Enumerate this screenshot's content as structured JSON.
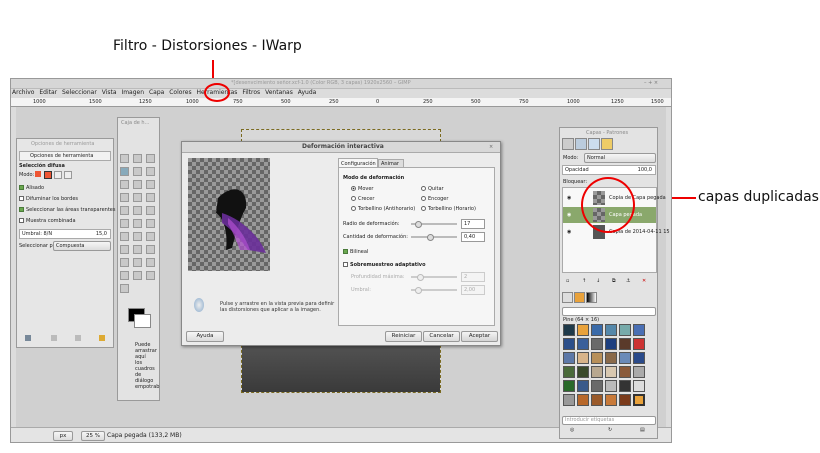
{
  "annotations": {
    "main_caption": "Filtro - Distorsiones - IWarp",
    "side_caption": "capas duplicadas"
  },
  "app": {
    "title": "*[desenvcimiento señor.xcf-1.0 (Color RGB, 3 capas) 1920x2560 – GIMP",
    "menu": [
      "Archivo",
      "Editar",
      "Seleccionar",
      "Vista",
      "Imagen",
      "Capa",
      "Colores",
      "Herramientas",
      "Filtros",
      "Ventanas",
      "Ayuda"
    ],
    "ruler_marks": [
      "1000",
      "1500",
      "1250",
      "1000",
      "750",
      "500",
      "250",
      "0",
      "250",
      "500",
      "750",
      "1000",
      "1250",
      "1500",
      "1750",
      "2000"
    ],
    "status": {
      "unit": "px",
      "zoom": "25 %",
      "message": "Capa pegada (133,2 MB)"
    }
  },
  "tool_options": {
    "title": "Opciones de herramienta",
    "tab": "Opciones de herramienta",
    "section": "Selección difusa",
    "mode_label": "Modo:",
    "options": [
      {
        "label": "Alisado",
        "checked": true
      },
      {
        "label": "Difuminar los bordes",
        "checked": false
      },
      {
        "label": "Seleccionar las áreas transparentes",
        "checked": true
      },
      {
        "label": "Muestra combinada",
        "checked": false
      }
    ],
    "threshold_label": "Umbral: 8/N",
    "threshold_value": "15,0",
    "select_by_label": "Seleccionar por:",
    "select_by_value": "Compuesta"
  },
  "toolbox": {
    "title": "Caja de h...",
    "hint": [
      "Puede",
      "arrastrar",
      "aquí",
      "los",
      "cuadros",
      "de",
      "diálogo",
      "empotrab"
    ]
  },
  "dialog": {
    "title": "Deformación interactiva",
    "tabs": [
      "Configuración",
      "Animar"
    ],
    "mode_heading": "Modo de deformación",
    "modes": [
      {
        "label": "Mover",
        "selected": true
      },
      {
        "label": "Quitar",
        "selected": false
      },
      {
        "label": "Crecer",
        "selected": false
      },
      {
        "label": "Encoger",
        "selected": false
      },
      {
        "label": "Torbellino (Antihorario)",
        "selected": false
      },
      {
        "label": "Torbellino (Horario)",
        "selected": false
      }
    ],
    "radius_label": "Radio de deformación:",
    "radius_value": "17",
    "amount_label": "Cantidad de deformación:",
    "amount_value": "0,40",
    "bilinear_label": "Bilineal",
    "bilinear_checked": true,
    "supersample_label": "Sobremuestreo adaptativo",
    "supersample_checked": false,
    "depth_label": "Profundidad máxima:",
    "depth_value": "2",
    "threshold_label": "Umbral:",
    "threshold_value": "2,00",
    "hint": "Pulse y arrastre en la vista previa para definir las distorsiones que aplicar a la imagen.",
    "buttons": {
      "help": "Ayuda",
      "reset": "Reiniciar",
      "cancel": "Cancelar",
      "ok": "Aceptar"
    }
  },
  "layers": {
    "title": "Capas - Patrones",
    "mode_label": "Modo:",
    "mode_value": "Normal",
    "opacity_label": "Opacidad",
    "opacity_value": "100,0",
    "lock_label": "Bloquear:",
    "items": [
      {
        "name": "Copia de Capa pegada",
        "selected": false
      },
      {
        "name": "Capa pegada",
        "selected": true
      },
      {
        "name": "Copia de 2014-04-11 15",
        "selected": false
      }
    ],
    "patterns_label": "Pine (64 × 16)",
    "tags_placeholder": "Introducir etiquetas"
  },
  "colors": {
    "annotation_red": "#e00000",
    "layer_selected": "#8aa86c",
    "dialog_bg": "#ececec"
  }
}
